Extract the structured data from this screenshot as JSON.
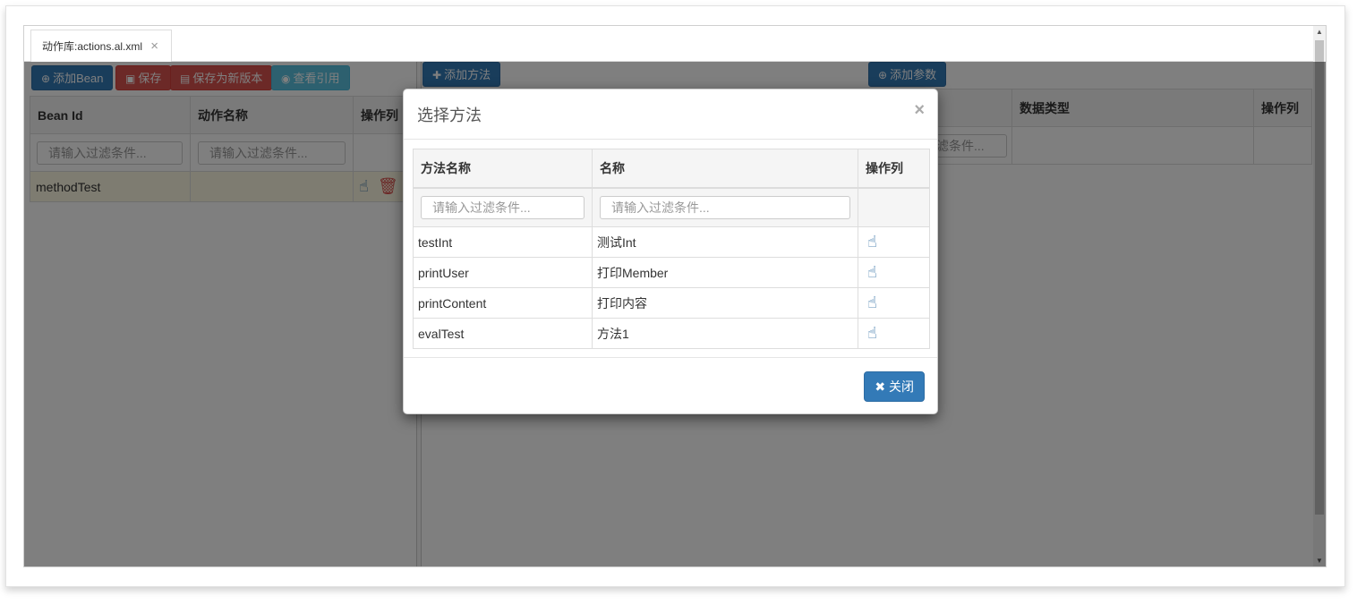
{
  "tab": {
    "title": "动作库:actions.al.xml",
    "close": "×"
  },
  "left_toolbar": {
    "add_bean": "添加Bean",
    "save": "保存",
    "save_as_new": "保存为新版本",
    "view_refs": "查看引用"
  },
  "bean_table": {
    "columns": [
      "Bean Id",
      "动作名称",
      "操作列"
    ],
    "filter_placeholder": "请输入过滤条件...",
    "rows": [
      {
        "bean_id": "methodTest",
        "action_name": ""
      }
    ]
  },
  "middle_toolbar": {
    "add_method": "添加方法"
  },
  "param_toolbar": {
    "add_param": "添加参数"
  },
  "param_table": {
    "columns": [
      "数据类型",
      "操作列"
    ],
    "filter_partial": "滤条件..."
  },
  "modal": {
    "title": "选择方法",
    "close_x": "×",
    "columns": [
      "方法名称",
      "名称",
      "操作列"
    ],
    "filter_placeholder": "请输入过滤条件...",
    "rows": [
      {
        "method": "testInt",
        "name": "测试Int"
      },
      {
        "method": "printUser",
        "name": "打印Member"
      },
      {
        "method": "printContent",
        "name": "打印内容"
      },
      {
        "method": "evalTest",
        "name": "方法1"
      }
    ],
    "close_button": "关闭"
  },
  "icons": {
    "add": "plus-circle-icon",
    "save": "floppy-icon",
    "save_as": "file-icon",
    "view": "eye-icon",
    "select": "hand-pointer-icon",
    "delete": "trash-icon",
    "close_btn": "times-icon"
  },
  "colors": {
    "primary": "#337ab7",
    "danger": "#d9534f",
    "info": "#5bc0de"
  }
}
